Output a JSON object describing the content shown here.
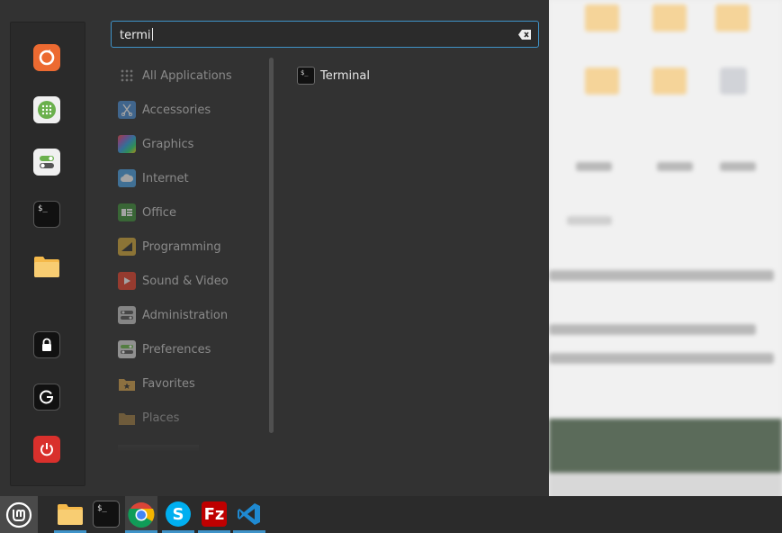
{
  "search": {
    "query": "termi"
  },
  "categories": [
    {
      "label": "All Applications",
      "icon": "grid-icon"
    },
    {
      "label": "Accessories",
      "icon": "scissors-icon"
    },
    {
      "label": "Graphics",
      "icon": "graphics-icon"
    },
    {
      "label": "Internet",
      "icon": "cloud-icon"
    },
    {
      "label": "Office",
      "icon": "office-icon"
    },
    {
      "label": "Programming",
      "icon": "programming-icon"
    },
    {
      "label": "Sound & Video",
      "icon": "play-icon"
    },
    {
      "label": "Administration",
      "icon": "administration-icon"
    },
    {
      "label": "Preferences",
      "icon": "preferences-icon"
    },
    {
      "label": "Favorites",
      "icon": "star-folder-icon"
    },
    {
      "label": "Places",
      "icon": "folder-icon"
    }
  ],
  "results": [
    {
      "label": "Terminal",
      "icon": "terminal-icon"
    }
  ],
  "favorites": [
    {
      "name": "firefox",
      "icon": "firefox-icon"
    },
    {
      "name": "software-manager",
      "icon": "grid-dots-icon"
    },
    {
      "name": "system-settings",
      "icon": "toggles-icon"
    },
    {
      "name": "terminal",
      "icon": "terminal-icon"
    },
    {
      "name": "files",
      "icon": "folder-icon"
    },
    {
      "name": "lock-screen",
      "icon": "lock-icon"
    },
    {
      "name": "logout",
      "icon": "logout-icon"
    },
    {
      "name": "shutdown",
      "icon": "power-icon"
    }
  ],
  "taskbar": [
    {
      "name": "menu",
      "icon": "mint-logo-icon"
    },
    {
      "name": "files",
      "icon": "folder-icon"
    },
    {
      "name": "terminal",
      "icon": "terminal-icon"
    },
    {
      "name": "chrome",
      "icon": "chrome-icon",
      "active": true
    },
    {
      "name": "skype",
      "icon": "skype-icon"
    },
    {
      "name": "filezilla",
      "icon": "filezilla-icon"
    },
    {
      "name": "vscode",
      "icon": "vscode-icon"
    }
  ],
  "colors": {
    "accent": "#3f93c8",
    "menu_bg": "#323232",
    "power_red": "#d9302c",
    "firefox_orange": "#ec6a31"
  }
}
